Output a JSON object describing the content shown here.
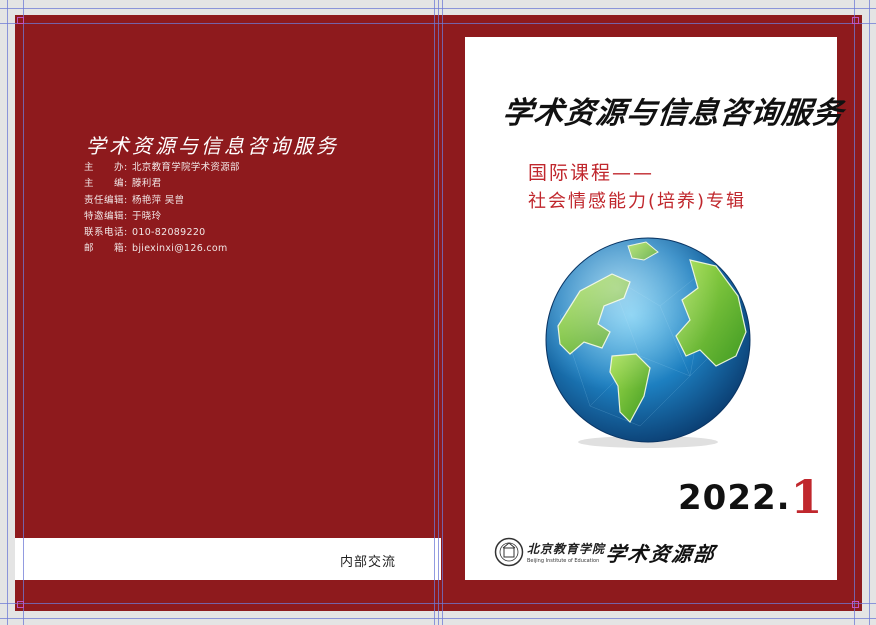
{
  "back_cover": {
    "title": "学术资源与信息咨询服务",
    "masthead": [
      {
        "key": "主　　办:",
        "value": "北京教育学院学术资源部"
      },
      {
        "key": "主　　编:",
        "value": "滕利君"
      },
      {
        "key": "责任编辑:",
        "value": "杨艳萍 吴曾"
      },
      {
        "key": "特邀编辑:",
        "value": "于晓玲"
      },
      {
        "key": "联系电话:",
        "value": "010-82089220"
      },
      {
        "key": "邮　　箱:",
        "value": "bjiexinxi@126.com"
      }
    ],
    "footer_label": "内部交流"
  },
  "front_cover": {
    "title": "学术资源与信息咨询服务",
    "subtitle_line1": "国际课程——",
    "subtitle_line2": "社会情感能力(培养)专辑",
    "year_prefix": "2022.",
    "issue": "1",
    "institution_name": "北京教育学院",
    "institution_en": "Beijing Institute of Education",
    "department": "学术资源部"
  },
  "colors": {
    "spread_red": "#8e1a1d",
    "accent_red": "#c0272d",
    "guide_blue": "#6d7ad6"
  },
  "icons": [
    "globe-illustration",
    "institution-logo-icon"
  ]
}
